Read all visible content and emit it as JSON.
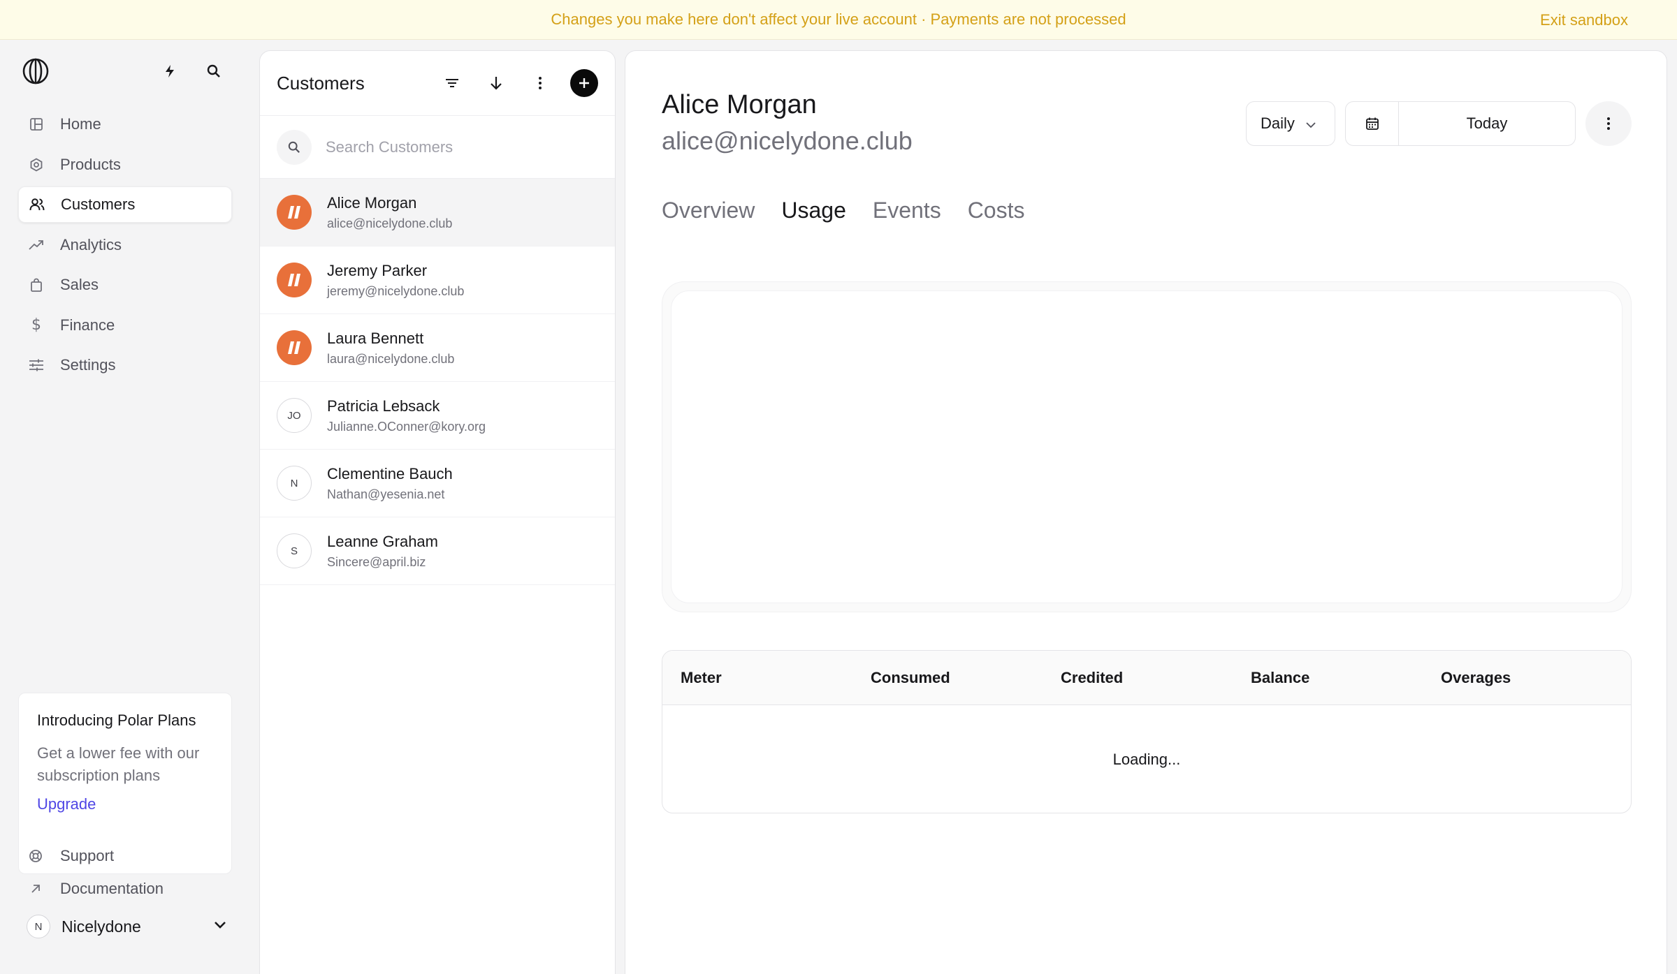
{
  "banner": {
    "message": "Changes you make here don't affect your live account · Payments are not processed",
    "exit_label": "Exit sandbox"
  },
  "sidebar": {
    "items": [
      {
        "label": "Home",
        "icon": "home-grid-icon"
      },
      {
        "label": "Products",
        "icon": "hexagon-icon"
      },
      {
        "label": "Customers",
        "icon": "users-icon"
      },
      {
        "label": "Analytics",
        "icon": "trend-icon"
      },
      {
        "label": "Sales",
        "icon": "shopping-bag-icon"
      },
      {
        "label": "Finance",
        "icon": "dollar-icon"
      },
      {
        "label": "Settings",
        "icon": "sliders-icon"
      }
    ],
    "active_item": "Customers",
    "promo": {
      "title": "Introducing Polar Plans",
      "description": "Get a lower fee with our subscription plans",
      "link": "Upgrade"
    },
    "support_label": "Support",
    "docs_label": "Documentation",
    "org": {
      "initial": "N",
      "name": "Nicelydone"
    }
  },
  "customers_panel": {
    "title": "Customers",
    "search_placeholder": "Search Customers",
    "customers": [
      {
        "name": "Alice Morgan",
        "email": "alice@nicelydone.club",
        "avatar": "brand",
        "initials": ""
      },
      {
        "name": "Jeremy Parker",
        "email": "jeremy@nicelydone.club",
        "avatar": "brand",
        "initials": ""
      },
      {
        "name": "Laura Bennett",
        "email": "laura@nicelydone.club",
        "avatar": "brand",
        "initials": ""
      },
      {
        "name": "Patricia Lebsack",
        "email": "Julianne.OConner@kory.org",
        "avatar": "initials",
        "initials": "JO"
      },
      {
        "name": "Clementine Bauch",
        "email": "Nathan@yesenia.net",
        "avatar": "initials",
        "initials": "N"
      },
      {
        "name": "Leanne Graham",
        "email": "Sincere@april.biz",
        "avatar": "initials",
        "initials": "S"
      }
    ]
  },
  "detail": {
    "name": "Alice Morgan",
    "email": "alice@nicelydone.club",
    "interval": "Daily",
    "date_label": "Today",
    "tabs": [
      "Overview",
      "Usage",
      "Events",
      "Costs"
    ],
    "active_tab": "Usage",
    "table": {
      "columns": [
        "Meter",
        "Consumed",
        "Credited",
        "Balance",
        "Overages"
      ],
      "status": "Loading..."
    }
  },
  "colors": {
    "banner_text": "#d4a017",
    "brand_avatar": "#e8703a",
    "link": "#4f46e5"
  }
}
